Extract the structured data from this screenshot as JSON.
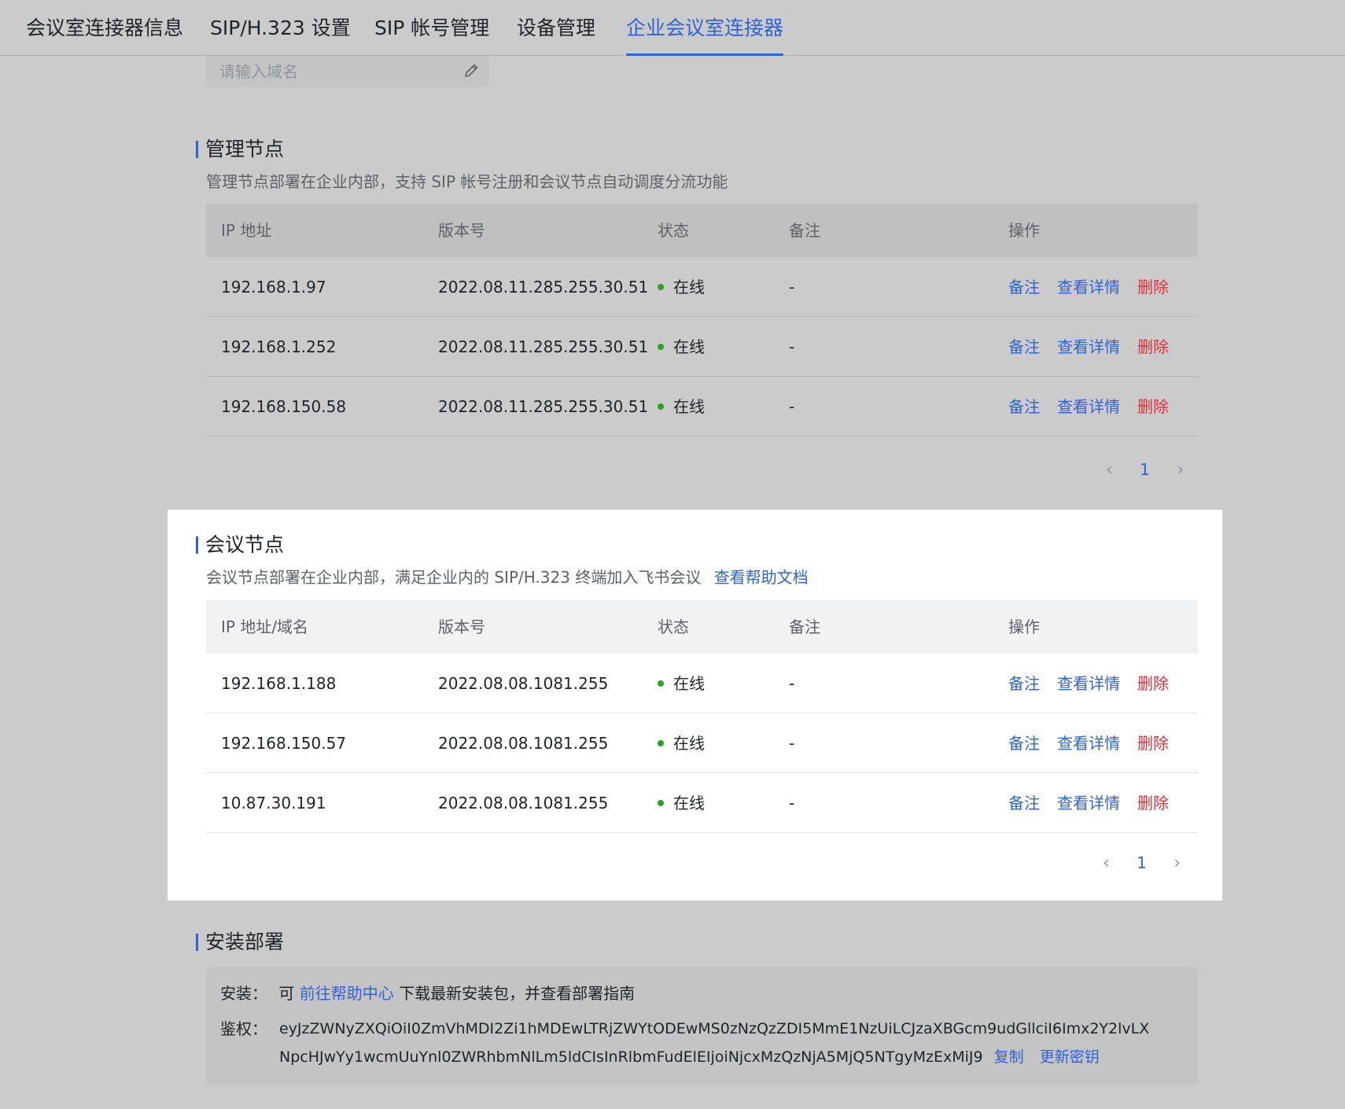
{
  "tabs": [
    {
      "label": "会议室连接器信息"
    },
    {
      "label": "SIP/H.323 设置"
    },
    {
      "label": "SIP 帐号管理"
    },
    {
      "label": "设备管理"
    },
    {
      "label": "企业会议室连接器"
    }
  ],
  "domain_input": {
    "placeholder": "请输入域名"
  },
  "management": {
    "title": "管理节点",
    "description": "管理节点部署在企业内部，支持 SIP 帐号注册和会议节点自动调度分流功能",
    "columns": [
      "IP 地址",
      "版本号",
      "状态",
      "备注",
      "操作"
    ],
    "rows": [
      {
        "ip": "192.168.1.97",
        "version": "2022.08.11.285.255.30.51",
        "status": "在线",
        "note": "-"
      },
      {
        "ip": "192.168.1.252",
        "version": "2022.08.11.285.255.30.51",
        "status": "在线",
        "note": "-"
      },
      {
        "ip": "192.168.150.58",
        "version": "2022.08.11.285.255.30.51",
        "status": "在线",
        "note": "-"
      }
    ],
    "page": "1"
  },
  "meeting": {
    "title": "会议节点",
    "description": "会议节点部署在企业内部，满足企业内的 SIP/H.323 终端加入飞书会议",
    "help_link": "查看帮助文档",
    "columns": [
      "IP 地址/域名",
      "版本号",
      "状态",
      "备注",
      "操作"
    ],
    "rows": [
      {
        "ip": "192.168.1.188",
        "version": "2022.08.08.1081.255",
        "status": "在线",
        "note": "-"
      },
      {
        "ip": "192.168.150.57",
        "version": "2022.08.08.1081.255",
        "status": "在线",
        "note": "-"
      },
      {
        "ip": "10.87.30.191",
        "version": "2022.08.08.1081.255",
        "status": "在线",
        "note": "-"
      }
    ],
    "page": "1"
  },
  "actions": {
    "note": "备注",
    "details": "查看详情",
    "delete": "删除"
  },
  "install": {
    "title": "安装部署",
    "install_label": "安装：",
    "install_prefix": "可",
    "install_link": "前往帮助中心",
    "install_suffix": "下载最新安装包，并查看部署指南",
    "auth_label": "鉴权：",
    "auth_line1": "eyJzZWNyZXQiOiI0ZmVhMDI2Zi1hMDEwLTRjZWYtODEwMS0zNzQzZDI5MmE1NzUiLCJzaXBGcm9udGllciI6Imx2Y2lvLX",
    "auth_line2": "NpcHJwYy1wcmUuYnl0ZWRhbmNlLm5ldCIsInRlbmFudElEIjoiNjcxMzQzNjA5MjQ5NTgyMzExMiJ9",
    "copy": "复制",
    "refresh": "更新密钥"
  },
  "colors": {
    "accent": "#2f63d6",
    "danger": "#e0303a",
    "online": "#2ea121"
  }
}
